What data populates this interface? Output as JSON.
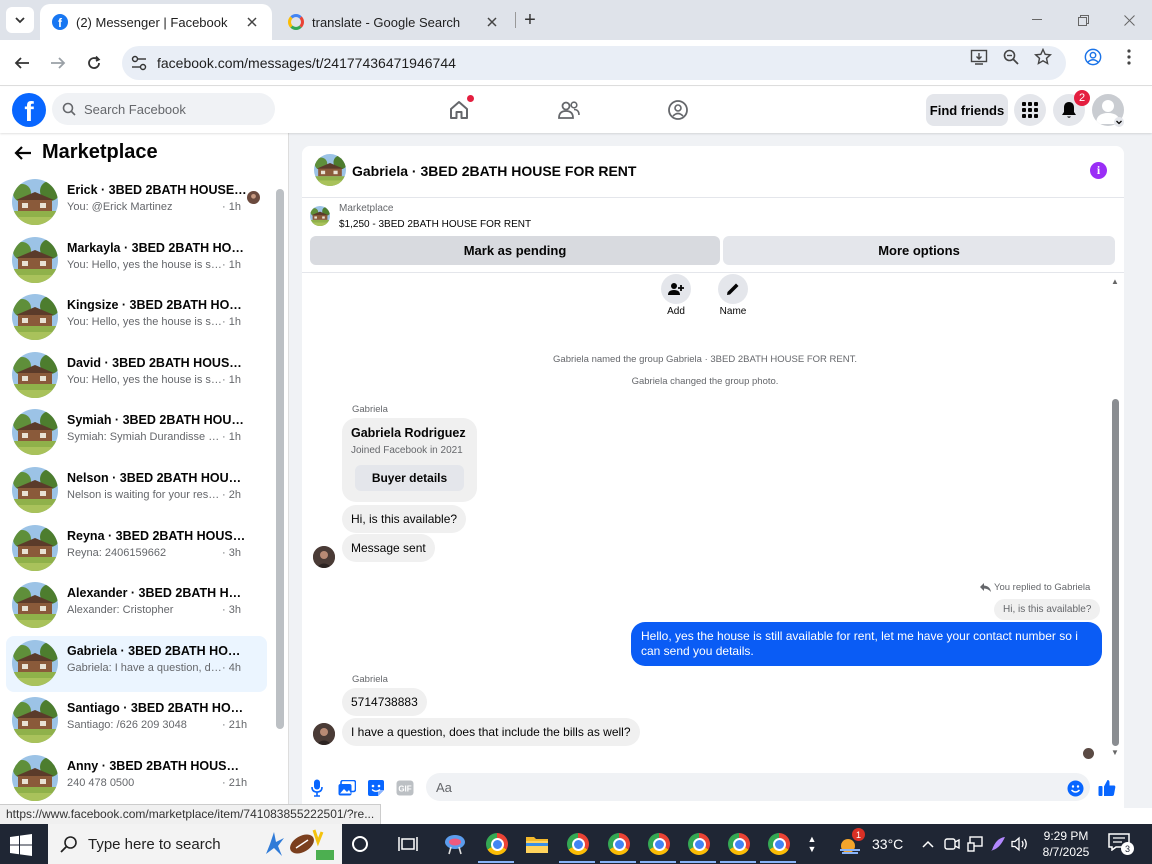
{
  "browser": {
    "tabs": [
      {
        "title": "(2) Messenger | Facebook",
        "active": true
      },
      {
        "title": "translate - Google Search",
        "active": false
      }
    ],
    "url": "facebook.com/messages/t/24177436471946744",
    "status_url": "https://www.facebook.com/marketplace/item/741083855222501/?re..."
  },
  "fb_header": {
    "search_placeholder": "Search Facebook",
    "find_friends_label": "Find friends",
    "notifications_count": "2"
  },
  "sidebar": {
    "title": "Marketplace",
    "conversations": [
      {
        "name": "Erick · 3BED 2BATH HOUSE F...",
        "preview": "You: @Erick Martinez",
        "time": "· 1h",
        "seen": true
      },
      {
        "name": "Markayla · 3BED 2BATH HOUSE ...",
        "preview": "You: Hello, yes the house is still av...",
        "time": "· 1h"
      },
      {
        "name": "Kingsize · 3BED 2BATH HOUSE ...",
        "preview": "You: Hello, yes the house is still av...",
        "time": "· 1h"
      },
      {
        "name": "David · 3BED 2BATH HOUSE FO...",
        "preview": "You: Hello, yes the house is still av...",
        "time": "· 1h"
      },
      {
        "name": "Symiah · 3BED 2BATH HOUSE F...",
        "preview": "Symiah: Symiah Durandisse (240)6...",
        "time": "· 1h"
      },
      {
        "name": "Nelson · 3BED 2BATH HOUSE F...",
        "preview": "Nelson is waiting for your response.",
        "time": "· 2h"
      },
      {
        "name": "Reyna · 3BED 2BATH HOUSE FO...",
        "preview": "Reyna: 2406159662",
        "time": "· 3h"
      },
      {
        "name": "Alexander · 3BED 2BATH HOUS...",
        "preview": "Alexander: Cristopher",
        "time": "· 3h"
      },
      {
        "name": "Gabriela · 3BED 2BATH HOUSE ...",
        "preview": "Gabriela: I have a question, does t...",
        "time": "· 4h",
        "selected": true
      },
      {
        "name": "Santiago · 3BED 2BATH HOUSE ...",
        "preview": "Santiago: /626 209 3048",
        "time": "· 21h"
      },
      {
        "name": "Anny · 3BED 2BATH HOUSE FO...",
        "preview": "240 478 0500",
        "time": "· 21h"
      }
    ]
  },
  "chat": {
    "title": "Gabriela · 3BED 2BATH HOUSE FOR RENT",
    "listing_label": "Marketplace",
    "listing_price": "$1,250 - 3BED 2BATH HOUSE FOR RENT",
    "mark_pending_label": "Mark as pending",
    "more_options_label": "More options",
    "add_label": "Add",
    "name_label": "Name",
    "system_messages": [
      "Gabriela named the group Gabriela · 3BED 2BATH HOUSE FOR RENT.",
      "Gabriela changed the group photo."
    ],
    "sender_name": "Gabriela",
    "profile_card": {
      "name": "Gabriela Rodriguez",
      "subtitle": "Joined Facebook in 2021",
      "button": "Buyer details"
    },
    "messages_block1": [
      "Hi, is this available?",
      "Message sent"
    ],
    "reply_note": "You replied to Gabriela",
    "quoted": "Hi, is this available?",
    "outgoing": "Hello, yes the house is still available for rent, let me have your contact number so i can send you details.",
    "messages_block2": [
      "5714738883",
      "I have a question, does that include the bills as well?"
    ],
    "composer_placeholder": "Aa"
  },
  "taskbar": {
    "search_placeholder": "Type here to search",
    "weather_temp": "33°C",
    "weather_badge": "1",
    "time": "9:29 PM",
    "date": "8/7/2025",
    "notifications": "3"
  },
  "colors": {
    "fb_blue": "#0866ff",
    "outgoing_bubble": "#0a5cf5",
    "selected_row": "#ebf5ff",
    "info_purple": "#9a2ef6"
  }
}
